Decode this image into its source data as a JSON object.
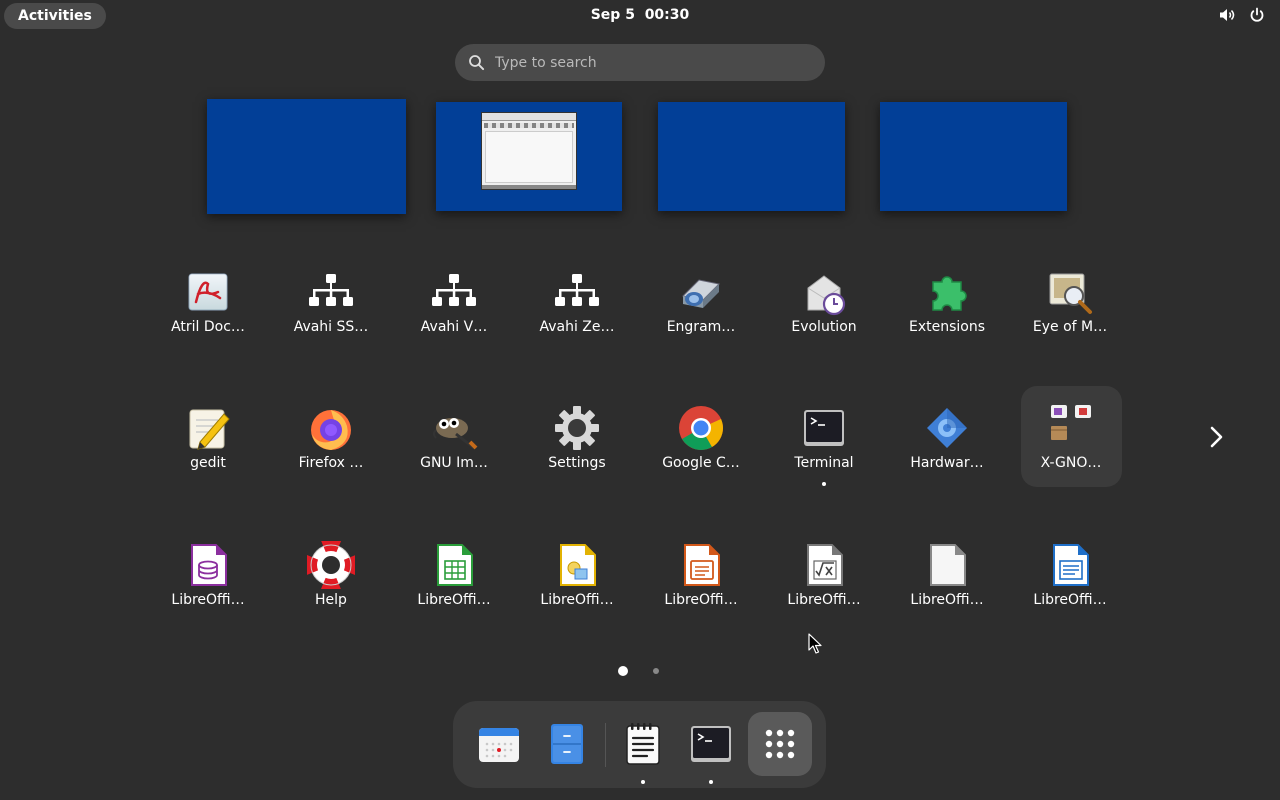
{
  "topbar": {
    "activities_label": "Activities",
    "clock_date": "Sep 5",
    "clock_time": "00:30",
    "tray_icons": [
      "volume-icon",
      "power-icon"
    ]
  },
  "search": {
    "placeholder": "Type to search",
    "value": ""
  },
  "workspaces": [
    {
      "name": "workspace-1",
      "has_window": false
    },
    {
      "name": "workspace-2",
      "has_window": true
    },
    {
      "name": "workspace-3",
      "has_window": false
    },
    {
      "name": "workspace-4",
      "has_window": false
    }
  ],
  "app_grid": {
    "row1": [
      {
        "label": "Atril Doc…",
        "icon": "atril-document-viewer-icon"
      },
      {
        "label": "Avahi SS…",
        "icon": "network-icon"
      },
      {
        "label": "Avahi V…",
        "icon": "network-icon"
      },
      {
        "label": "Avahi Ze…",
        "icon": "network-icon"
      },
      {
        "label": "Engram…",
        "icon": "engrampa-archive-icon"
      },
      {
        "label": "Evolution",
        "icon": "evolution-mail-icon"
      },
      {
        "label": "Extensions",
        "icon": "puzzle-piece-icon"
      },
      {
        "label": "Eye of M…",
        "icon": "image-viewer-icon"
      }
    ],
    "row2": [
      {
        "label": "gedit",
        "icon": "gedit-icon"
      },
      {
        "label": "Firefox …",
        "icon": "firefox-icon"
      },
      {
        "label": "GNU Im…",
        "icon": "gimp-icon"
      },
      {
        "label": "Settings",
        "icon": "gear-icon"
      },
      {
        "label": "Google C…",
        "icon": "chrome-icon"
      },
      {
        "label": "Terminal",
        "icon": "terminal-icon",
        "running": true
      },
      {
        "label": "Hardwar…",
        "icon": "hardware-icon"
      },
      {
        "label": "X-GNO…",
        "icon": "folder-icon",
        "folder": true
      }
    ],
    "row3": [
      {
        "label": "LibreOffi…",
        "icon": "libreoffice-base-icon"
      },
      {
        "label": "Help",
        "icon": "lifebuoy-icon"
      },
      {
        "label": "LibreOffi…",
        "icon": "libreoffice-calc-icon"
      },
      {
        "label": "LibreOffi…",
        "icon": "libreoffice-draw-icon"
      },
      {
        "label": "LibreOffi…",
        "icon": "libreoffice-impress-icon"
      },
      {
        "label": "LibreOffi…",
        "icon": "libreoffice-math-icon"
      },
      {
        "label": "LibreOffi…",
        "icon": "libreoffice-icon"
      },
      {
        "label": "LibreOffi…",
        "icon": "libreoffice-writer-icon"
      }
    ]
  },
  "pagination": {
    "pages": 2,
    "current_page": 1
  },
  "dock": {
    "items": [
      {
        "name": "calendar",
        "icon": "calendar-icon",
        "running": false
      },
      {
        "name": "files",
        "icon": "file-cabinet-icon",
        "running": false
      },
      {
        "name": "text-editor",
        "icon": "notepad-icon",
        "running": true
      },
      {
        "name": "terminal",
        "icon": "terminal-icon",
        "running": true
      },
      {
        "name": "show-apps",
        "icon": "app-grid-icon",
        "running": false,
        "active": true
      }
    ]
  },
  "colors": {
    "background": "#2d2d2d",
    "workspace": "#023f97",
    "pill": "#4a4a4a",
    "dock": "#3b3b3b"
  }
}
